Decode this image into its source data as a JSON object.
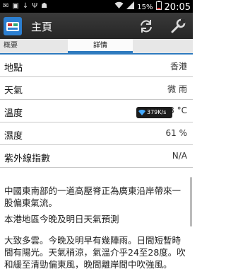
{
  "status_bar": {
    "battery_percent": "15%",
    "time": "20:05"
  },
  "action_bar": {
    "title": "主頁"
  },
  "tabs": [
    {
      "label": "概要"
    },
    {
      "label": "詳情"
    }
  ],
  "details": [
    {
      "label": "地點",
      "value": "香港"
    },
    {
      "label": "天氣",
      "value": "微 雨"
    },
    {
      "label": "溫度",
      "value": "28 °C"
    },
    {
      "label": "濕度",
      "value": "61 %"
    },
    {
      "label": "紫外線指數",
      "value": "N/A"
    }
  ],
  "network_overlay": {
    "speed": "379K/s"
  },
  "report": {
    "paragraph1": "中國東南部的一道高壓脊正為廣東沿岸帶來一股偏東氣流。",
    "heading": "本港地區今晚及明日天氣預測",
    "paragraph2": "大致多雲。今晚及明早有幾陣雨。日間短暫時間有陽光。天氣稍涼，氣溫介乎24至28度。吹和緩至清勁偏東風，晚間離岸間中吹強風。"
  }
}
